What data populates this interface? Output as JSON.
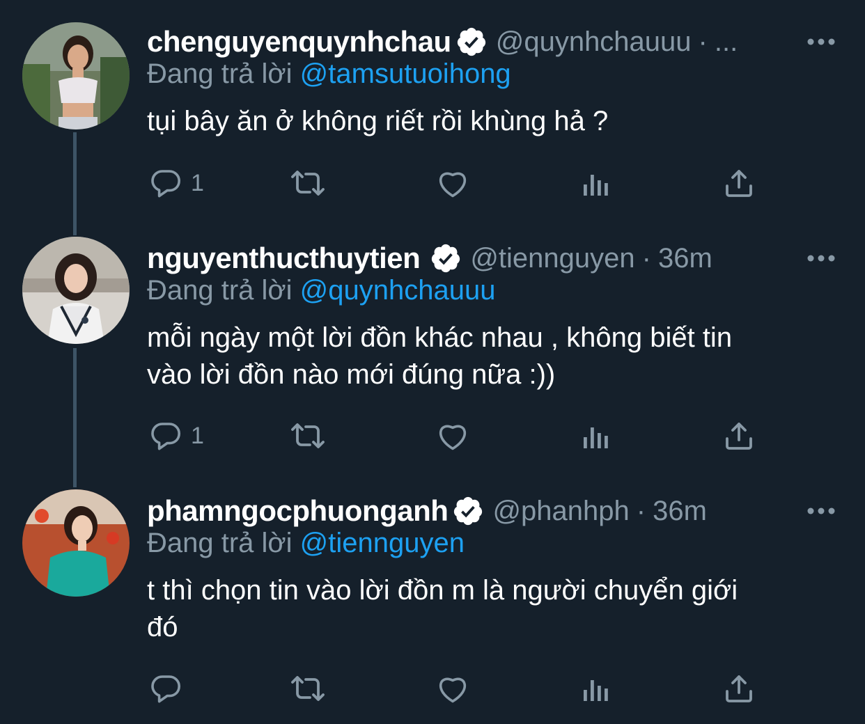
{
  "tweets": [
    {
      "display_name": "chenguyenquynhchau",
      "handle": "@quynhchauuu",
      "separator": "·",
      "time": "...",
      "replying_prefix": "Đang trả lời",
      "replying_to": "@tamsutuoihong",
      "text_lines": [
        "tụi bây ăn ở không riết rồi khùng hả ?"
      ],
      "reply_count": "1",
      "verified": true
    },
    {
      "display_name": "nguyenthucthuytien",
      "handle": "@tiennguyen",
      "separator": "·",
      "time": "36m",
      "replying_prefix": "Đang trả lời",
      "replying_to": "@quynhchauuu",
      "text_lines": [
        "mỗi ngày một lời đồn khác nhau , không biết tin",
        "vào lời đồn nào mới đúng nữa :))"
      ],
      "reply_count": "1",
      "verified": true
    },
    {
      "display_name": "phamngocphuonganh",
      "handle": "@phanhph",
      "separator": "·",
      "time": "36m",
      "replying_prefix": "Đang trả lời",
      "replying_to": "@tiennguyen",
      "text_lines": [
        "t thì chọn tin vào lời đồn m là người chuyển giới",
        "đó"
      ],
      "reply_count": "",
      "verified": true
    }
  ],
  "icons": {
    "verified": "verified-badge-icon",
    "more": "more-options-icon",
    "reply": "reply-icon",
    "retweet": "retweet-icon",
    "like": "like-icon",
    "analytics": "analytics-icon",
    "share": "share-icon"
  },
  "colors": {
    "background": "#15202b",
    "text": "#ffffff",
    "secondary_text": "#8899a6",
    "mention": "#1da1f2",
    "thread_line": "#3d5466"
  }
}
